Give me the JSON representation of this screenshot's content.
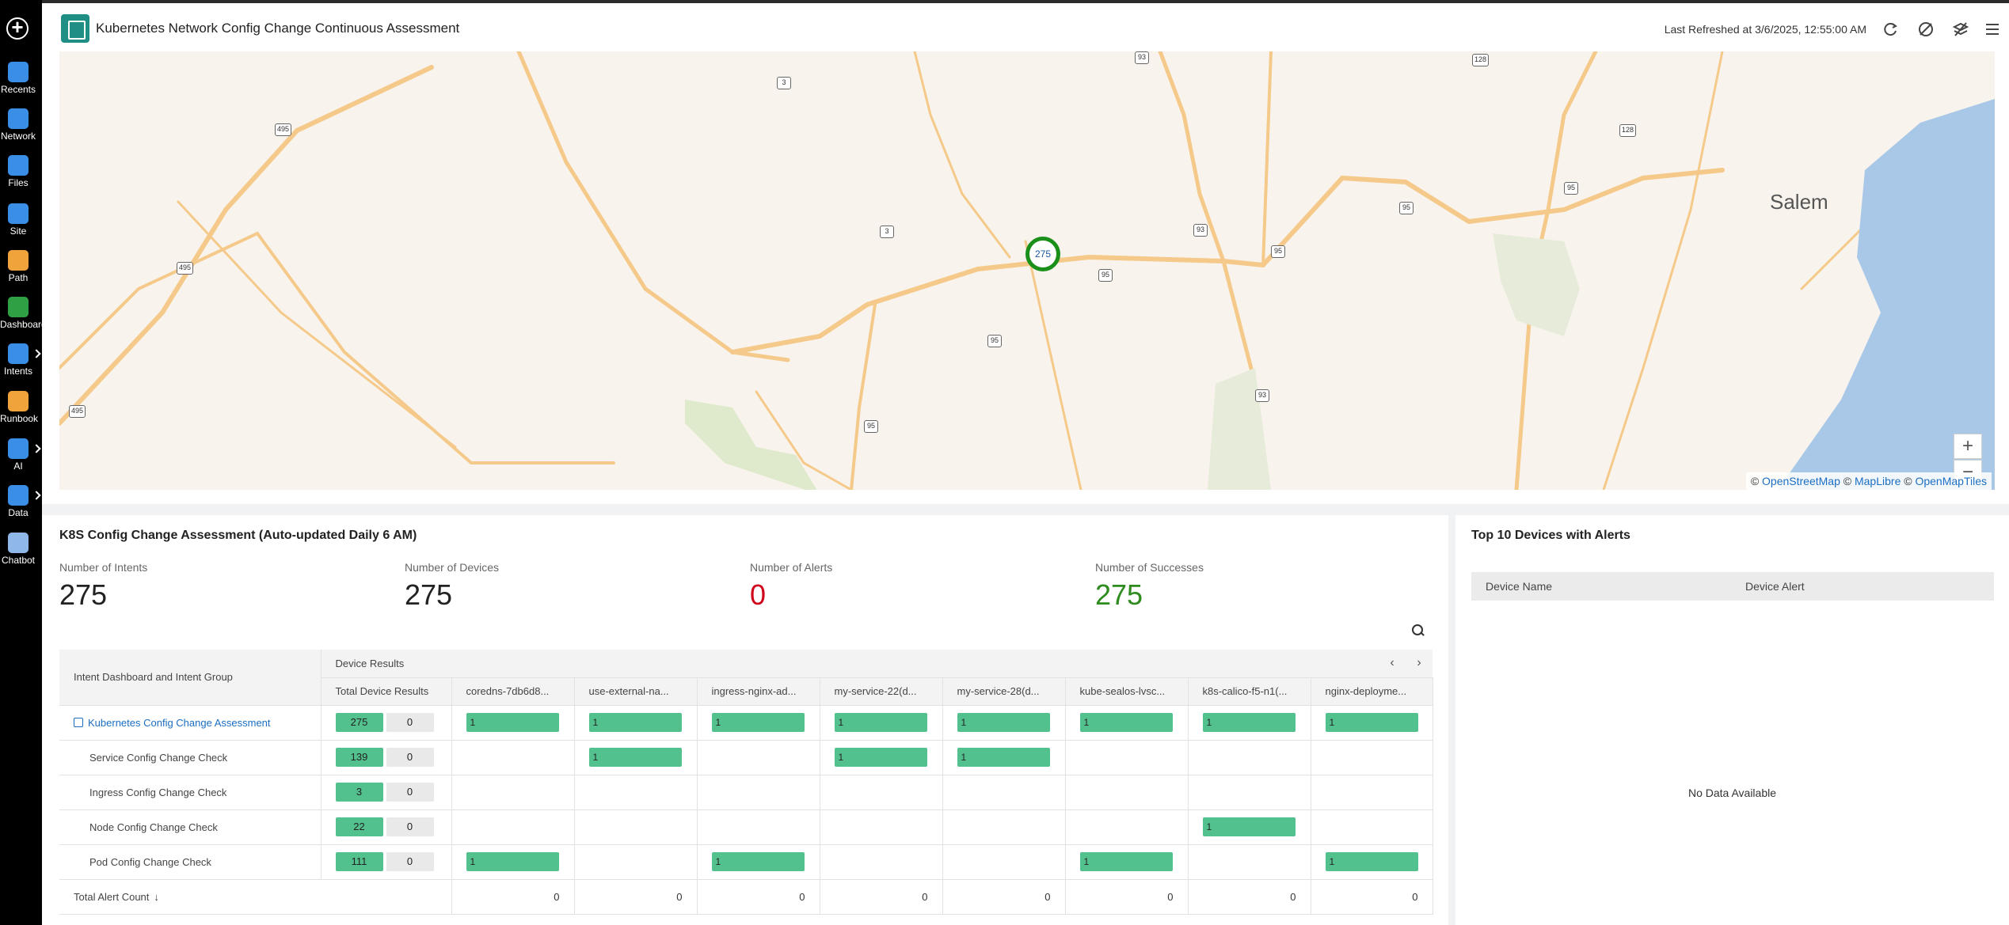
{
  "sidebar": {
    "items": [
      {
        "label": "Recents",
        "icon": "recents-icon",
        "color": "#3a8ee6"
      },
      {
        "label": "Network",
        "icon": "network-icon",
        "color": "#3a8ee6"
      },
      {
        "label": "Files",
        "icon": "files-icon",
        "color": "#3a8ee6"
      },
      {
        "label": "Site",
        "icon": "site-icon",
        "color": "#3a8ee6"
      },
      {
        "label": "Path",
        "icon": "path-icon",
        "color": "#f0a23b"
      },
      {
        "label": "Dashboard",
        "icon": "dashboard-icon",
        "color": "#2fa043"
      },
      {
        "label": "Intents",
        "icon": "intents-icon",
        "color": "#3a8ee6"
      },
      {
        "label": "Runbook",
        "icon": "runbook-icon",
        "color": "#f0a23b"
      },
      {
        "label": "AI",
        "icon": "ai-icon",
        "color": "#3a8ee6"
      },
      {
        "label": "Data",
        "icon": "data-icon",
        "color": "#3a8ee6"
      },
      {
        "label": "Chatbot",
        "icon": "chatbot-icon",
        "color": "#8fb8e8"
      }
    ]
  },
  "header": {
    "title": "Kubernetes Network Config Change Continuous Assessment",
    "last_refreshed": "Last Refreshed at 3/6/2025, 12:55:00 AM"
  },
  "map": {
    "city_label": "Salem",
    "cluster_count": "275",
    "zoom_in": "+",
    "zoom_out": "−",
    "attribution_prefix": "©",
    "attribution_links": [
      "OpenStreetMap",
      "MapLibre",
      "OpenMapTiles"
    ],
    "route_shields": [
      "495",
      "495",
      "495",
      "3",
      "3",
      "93",
      "93",
      "93",
      "95",
      "95",
      "95",
      "95",
      "95",
      "95",
      "128",
      "128"
    ]
  },
  "assessment": {
    "title": "K8S Config Change Assessment (Auto-updated Daily 6 AM)",
    "stats": [
      {
        "label": "Number of Intents",
        "value": "275",
        "color": "#222222"
      },
      {
        "label": "Number of Devices",
        "value": "275",
        "color": "#222222"
      },
      {
        "label": "Number of Alerts",
        "value": "0",
        "color": "#d0021b"
      },
      {
        "label": "Number of Successes",
        "value": "275",
        "color": "#2e8b1e"
      }
    ],
    "table": {
      "group_header": "Intent Dashboard and Intent Group",
      "device_results_header": "Device Results",
      "total_header": "Total Device Results",
      "device_columns": [
        "coredns-7db6d8...",
        "use-external-na...",
        "ingress-nginx-ad...",
        "my-service-22(d...",
        "my-service-28(d...",
        "kube-sealos-lvsc...",
        "k8s-calico-f5-n1(...",
        "nginx-deployme..."
      ],
      "rows": [
        {
          "name": "Kubernetes Config Change Assessment",
          "total": "275",
          "alerts": "0",
          "cells": [
            "1",
            "1",
            "1",
            "1",
            "1",
            "1",
            "1",
            "1"
          ]
        },
        {
          "name": "Service Config Change Check",
          "total": "139",
          "alerts": "0",
          "cells": [
            "",
            "1",
            "",
            "1",
            "1",
            "",
            "",
            ""
          ]
        },
        {
          "name": "Ingress Config Change Check",
          "total": "3",
          "alerts": "0",
          "cells": [
            "",
            "",
            "",
            "",
            "",
            "",
            "",
            ""
          ]
        },
        {
          "name": "Node Config Change Check",
          "total": "22",
          "alerts": "0",
          "cells": [
            "",
            "",
            "",
            "",
            "",
            "",
            "1",
            ""
          ]
        },
        {
          "name": "Pod Config Change Check",
          "total": "111",
          "alerts": "0",
          "cells": [
            "1",
            "",
            "1",
            "",
            "",
            "1",
            "",
            "1"
          ]
        }
      ],
      "footer_label": "Total Alert Count",
      "footer_sort_icon": "↓",
      "footer_values": [
        "0",
        "0",
        "0",
        "0",
        "0",
        "0",
        "0",
        "0"
      ],
      "prev": "‹",
      "next": "›"
    }
  },
  "top10": {
    "title": "Top 10 Devices with Alerts",
    "columns": [
      "Device Name",
      "Device Alert"
    ],
    "empty": "No Data Available"
  }
}
